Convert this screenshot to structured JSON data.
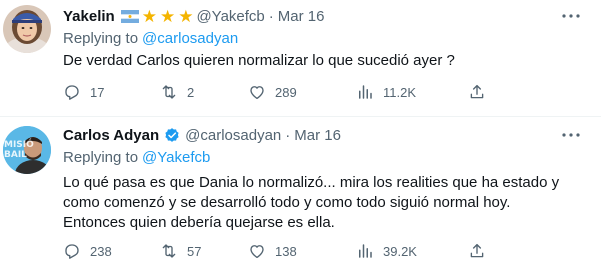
{
  "tweets": [
    {
      "author_name": "Yakelin",
      "author_handle": "@Yakefcb",
      "separator": "·",
      "date": "Mar 16",
      "has_flag": true,
      "stars": [
        "★",
        "★",
        "★"
      ],
      "replying_to_label": "Replying to",
      "replying_to_handle": "@carlosadyan",
      "text_lines": [
        "De verdad Carlos quieren normalizar lo que sucedió ayer ?"
      ],
      "stats": {
        "replies": "17",
        "retweets": "2",
        "likes": "289",
        "views": "11.2K"
      }
    },
    {
      "author_name": "Carlos Adyan",
      "author_handle": "@carlosadyan",
      "separator": "·",
      "date": "Mar 16",
      "verified": true,
      "avatar_overlay_text": "MISIÓ BAIL",
      "replying_to_label": "Replying to",
      "replying_to_handle": "@Yakefcb",
      "text_lines": [
        "Lo qué pasa es que Dania lo normalizó... mira los realities que ha estado y",
        "como comenzó y se desarrolló todo y como todo siguió normal hoy.",
        "Entonces quien debería quejarse es ella."
      ],
      "stats": {
        "replies": "238",
        "retweets": "57",
        "likes": "138",
        "views": "39.2K"
      }
    }
  ],
  "colors": {
    "accent": "#1d9bf0",
    "secondary_text": "#536471",
    "primary_text": "#0f1419",
    "star": "#f4b400",
    "divider": "#eff3f4"
  },
  "icons": [
    "reply-icon",
    "retweet-icon",
    "like-icon",
    "views-icon",
    "share-icon",
    "more-icon",
    "verified-icon",
    "argentina-flag-icon",
    "star-icon"
  ]
}
